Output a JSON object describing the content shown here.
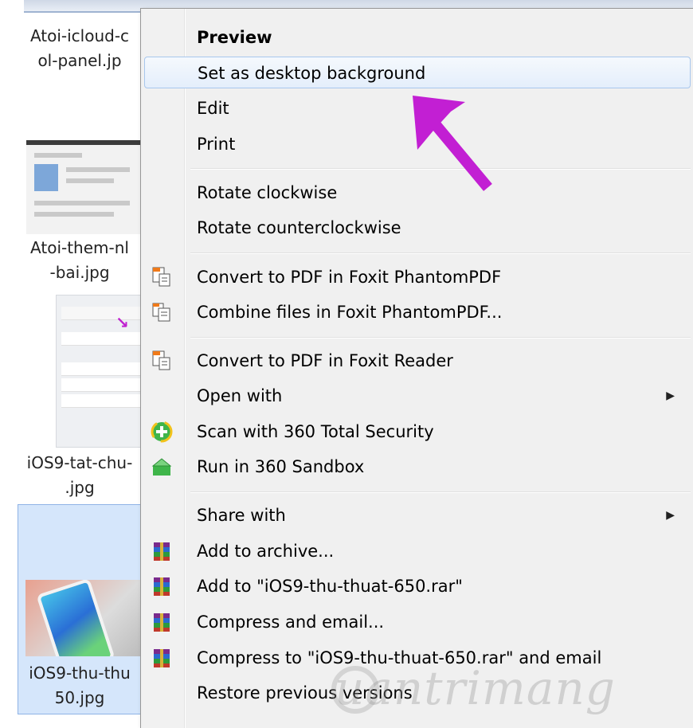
{
  "files": [
    {
      "caption": "Atoi-icloud-c\nol-panel.jp"
    },
    {
      "caption": "Atoi-them-nl\n-bai.jpg"
    },
    {
      "caption": "iOS9-tat-chu-\n.jpg"
    },
    {
      "caption": "iOS9-thu-thu\n50.jpg"
    }
  ],
  "menu": {
    "items": [
      {
        "label": "Preview",
        "icon": ""
      },
      {
        "label": "Set as desktop background",
        "icon": ""
      },
      {
        "label": "Edit",
        "icon": ""
      },
      {
        "label": "Print",
        "icon": ""
      },
      {
        "label": "Rotate clockwise",
        "icon": ""
      },
      {
        "label": "Rotate counterclockwise",
        "icon": ""
      },
      {
        "label": "Convert to PDF in Foxit PhantomPDF",
        "icon": "foxit-convert-icon"
      },
      {
        "label": "Combine files in Foxit PhantomPDF...",
        "icon": "foxit-combine-icon"
      },
      {
        "label": "Convert to PDF in Foxit Reader",
        "icon": "foxit-reader-icon"
      },
      {
        "label": "Open with",
        "icon": "",
        "submenu": true
      },
      {
        "label": "Scan with 360 Total Security",
        "icon": "360-scan-icon"
      },
      {
        "label": "Run in 360 Sandbox",
        "icon": "360-sandbox-icon"
      },
      {
        "label": "Share with",
        "icon": "",
        "submenu": true
      },
      {
        "label": "Add to archive...",
        "icon": "winrar-icon"
      },
      {
        "label": "Add to \"iOS9-thu-thuat-650.rar\"",
        "icon": "winrar-icon"
      },
      {
        "label": "Compress and email...",
        "icon": "winrar-icon"
      },
      {
        "label": "Compress to \"iOS9-thu-thuat-650.rar\" and email",
        "icon": "winrar-icon"
      },
      {
        "label": "Restore previous versions",
        "icon": ""
      }
    ],
    "hover_index": 1,
    "submenu_glyph": "▶"
  },
  "watermark": {
    "text": "uantrimang"
  },
  "colors": {
    "annotation_arrow": "#c21fd3",
    "menu_bg": "#f0f0f0",
    "hover_border": "#a8c7ed",
    "selection": "#d5e6fb"
  }
}
